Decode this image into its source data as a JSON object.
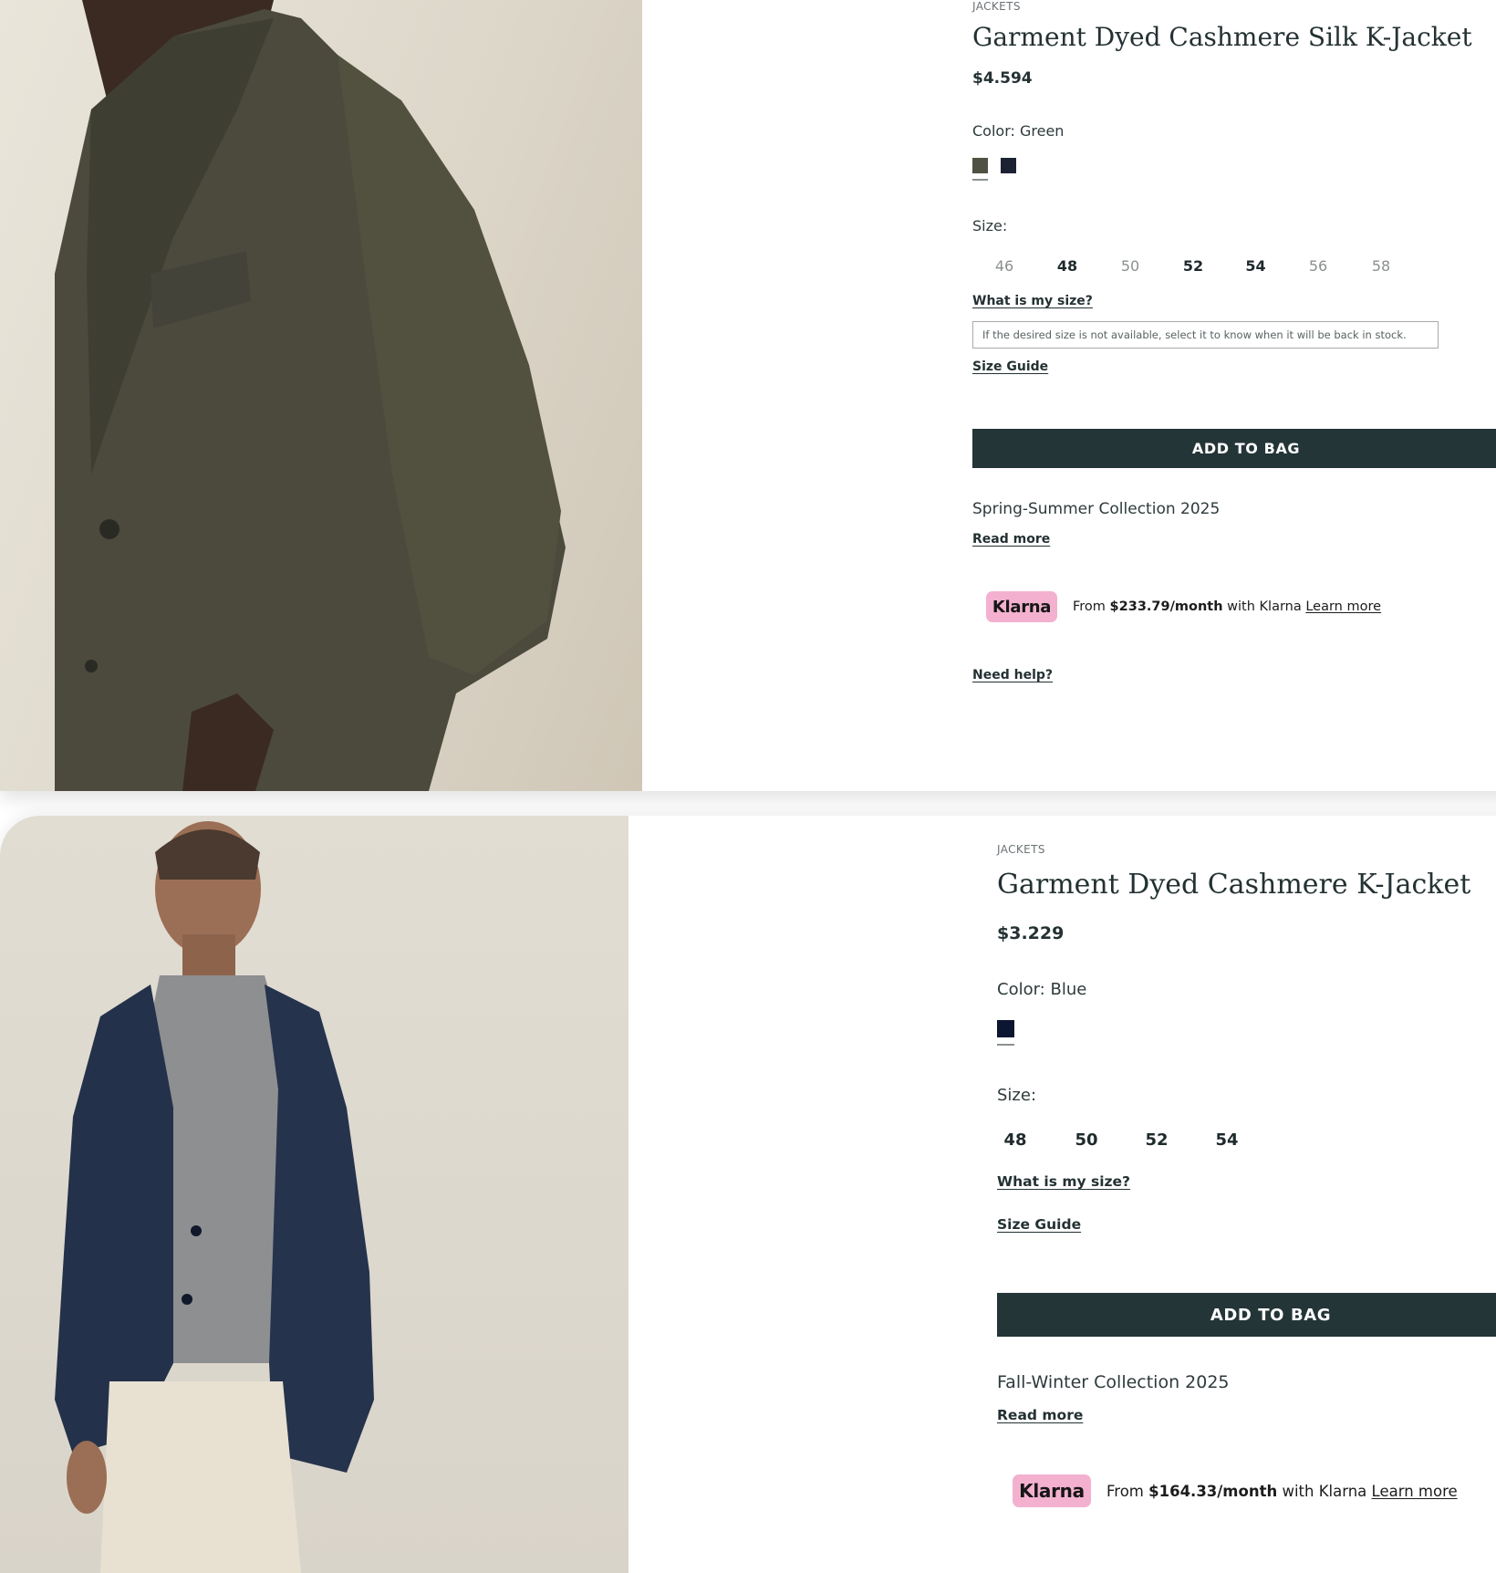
{
  "products": [
    {
      "category": "JACKETS",
      "title": "Garment Dyed Cashmere Silk K-Jacket",
      "price": "$4.594",
      "color_label": "Color: Green",
      "colors": [
        "#4f5142",
        "#1d2233"
      ],
      "size_label": "Size:",
      "sizes": [
        {
          "label": "46",
          "available": false
        },
        {
          "label": "48",
          "available": true
        },
        {
          "label": "50",
          "available": false
        },
        {
          "label": "52",
          "available": true
        },
        {
          "label": "54",
          "available": true
        },
        {
          "label": "56",
          "available": false
        },
        {
          "label": "58",
          "available": false
        }
      ],
      "what_size": "What is my size?",
      "stock_note": "If the desired size is not available, select it to know when it will be back in stock.",
      "size_guide": "Size Guide",
      "add_to_bag": "ADD TO BAG",
      "collection": "Spring-Summer Collection 2025",
      "read_more": "Read more",
      "klarna": {
        "badge": "Klarna",
        "prefix": "From ",
        "amount": "$233.79/month",
        "suffix": " with Klarna ",
        "learn": "Learn more"
      },
      "need_help": "Need help?"
    },
    {
      "category": "JACKETS",
      "title": "Garment Dyed Cashmere K-Jacket",
      "price": "$3.229",
      "color_label": "Color: Blue",
      "colors": [
        "#0d1630"
      ],
      "size_label": "Size:",
      "sizes": [
        {
          "label": "48",
          "available": true
        },
        {
          "label": "50",
          "available": true
        },
        {
          "label": "52",
          "available": true
        },
        {
          "label": "54",
          "available": true
        }
      ],
      "what_size": "What is my size?",
      "size_guide": "Size Guide",
      "add_to_bag": "ADD TO BAG",
      "collection": "Fall-Winter Collection 2025",
      "read_more": "Read more",
      "klarna": {
        "badge": "Klarna",
        "prefix": "From ",
        "amount": "$164.33/month",
        "suffix": " with Klarna ",
        "learn": "Learn more"
      }
    }
  ]
}
